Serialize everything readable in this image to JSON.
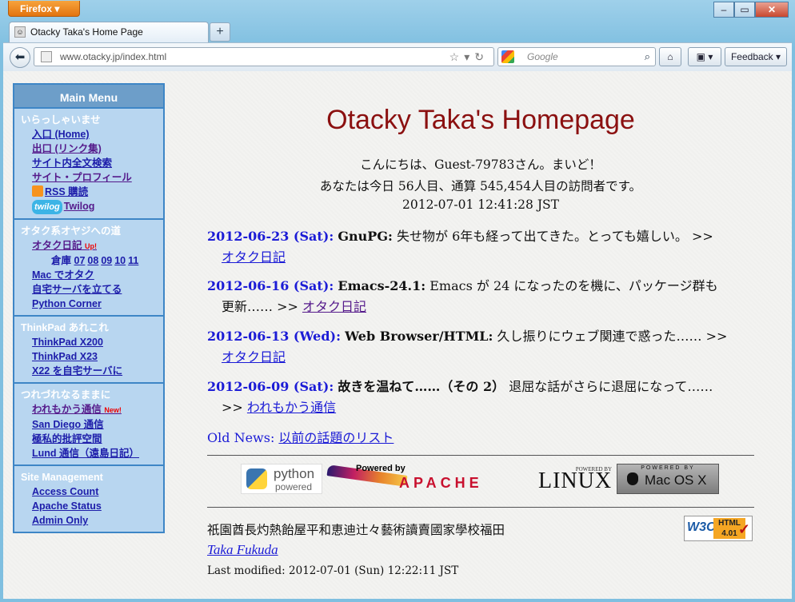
{
  "browser": {
    "menu_button": "Firefox",
    "tab_title": "Otacky Taka's Home Page",
    "new_tab": "+",
    "url": "www.otacky.jp/index.html",
    "search_placeholder": "Google",
    "feedback": "Feedback"
  },
  "sidebar": {
    "title": "Main Menu",
    "sections": [
      {
        "heading": "いらっしゃいませ",
        "links": [
          "入口 (Home)",
          "出口 (リンク集)",
          "サイト内全文検索",
          "サイト・プロフィール",
          "RSS 購読",
          "Twilog"
        ]
      },
      {
        "heading": "オタク系オヤジへの道",
        "links": [
          "オタク日記",
          "Mac でオタク",
          "自宅サーバを立てる",
          "Python Corner"
        ],
        "otaku_badge": "Up!",
        "soko_label": "倉庫",
        "soko_links": [
          "07",
          "08",
          "09",
          "10",
          "11"
        ]
      },
      {
        "heading": "ThinkPad あれこれ",
        "links": [
          "ThinkPad X200",
          "ThinkPad X23",
          "X22 を自宅サーバに"
        ]
      },
      {
        "heading": "つれづれなるままに",
        "links": [
          "われもかう通信",
          "San Diego 通信",
          "極私的批評空間",
          "Lund 通信（遠島日記）"
        ],
        "new_badge": "New!"
      },
      {
        "heading": "Site Management",
        "links": [
          "Access Count",
          "Apache Status",
          "Admin Only"
        ]
      }
    ]
  },
  "main": {
    "title": "Otacky Taka's Homepage",
    "greeting1": "こんにちは、Guest-79783さん。まいど！",
    "greeting2": "あなたは今日 56人目、通算 545,454人目の訪問者です。",
    "greeting3": "2012-07-01 12:41:28 JST",
    "news": [
      {
        "date": "2012-06-23 (Sat):",
        "subject": "GnuPG:",
        "text": "失せ物が 6年も経って出てきた。とっても嬉しい。 >>",
        "link": "オタク日記"
      },
      {
        "date": "2012-06-16 (Sat):",
        "subject": "Emacs-24.1:",
        "text": "Emacs が 24 になったのを機に、パッケージ群も",
        "text2": "更新…… >>",
        "link": "オタク日記"
      },
      {
        "date": "2012-06-13 (Wed):",
        "subject": "Web Browser/HTML:",
        "text": "久し振りにウェブ関連で惑った…… >>",
        "link": "オタク日記"
      },
      {
        "date": "2012-06-09 (Sat):",
        "subject": "故きを温ねて……（その 2）",
        "text": "退屈な話がさらに退屈になって……",
        "text2": ">>",
        "link": "われもかう通信"
      }
    ],
    "old_news_label": "Old News:",
    "old_news_link": "以前の話題のリスト",
    "logos": {
      "python1": "python",
      "python2": "powered",
      "apache_powered": "Powered by",
      "apache_name": "APACHE",
      "linux_powered": "POWERED BY",
      "linux_name": "LINUX",
      "mac_powered": "POWERED BY",
      "mac_name": "Mac OS X"
    },
    "kanji_line": "祇園酋長灼熱飴屋平和恵迪辻々藝術讀賣國家學校福田",
    "author": "Taka Fukuda",
    "modified": "Last modified: 2012-07-01 (Sun) 12:22:11 JST",
    "w3c_label": "W3C",
    "w3c_html": "HTML",
    "w3c_version": "4.01"
  }
}
